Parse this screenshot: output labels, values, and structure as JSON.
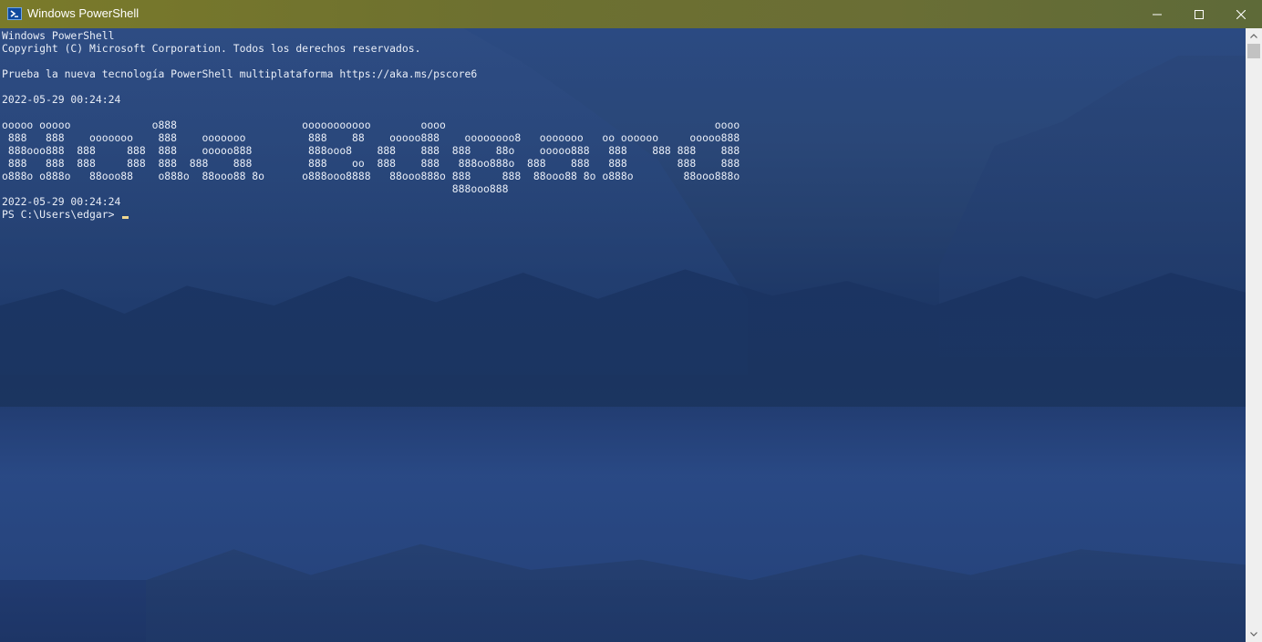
{
  "window": {
    "title": "Windows PowerShell",
    "icon": "powershell-icon",
    "controls": {
      "minimize": "minimize-icon",
      "maximize": "maximize-icon",
      "close": "close-icon"
    }
  },
  "console": {
    "lines": [
      "Windows PowerShell",
      "Copyright (C) Microsoft Corporation. Todos los derechos reservados.",
      "",
      "Prueba la nueva tecnología PowerShell multiplataforma https://aka.ms/pscore6",
      "",
      "2022-05-29 00:24:24",
      "",
      "ooooo ooooo             o888                    ooooooooooo        oooo                                           oooo",
      " 888   888    ooooooo    888    ooooooo          888    88    ooooo888    oooooooo8   ooooooo   oo oooooo     ooooo888",
      " 888ooo888  888     888  888    ooooo888         888ooo8    888    888  888    88o    ooooo888   888    888 888    888",
      " 888   888  888     888  888  888    888         888    oo  888    888   888oo888o  888    888   888        888    888",
      "o888o o888o   88ooo88    o888o  88ooo88 8o      o888ooo8888   88ooo888o 888     888  88ooo88 8o o888o        88ooo888o",
      "                                                                        888ooo888",
      "2022-05-29 00:24:24"
    ],
    "prompt": "PS C:\\Users\\edgar> "
  },
  "colors": {
    "titlebar": "#6d7030",
    "console_background": "#1b3566",
    "text": "#e9eef7",
    "cursor": "#f0d890"
  }
}
